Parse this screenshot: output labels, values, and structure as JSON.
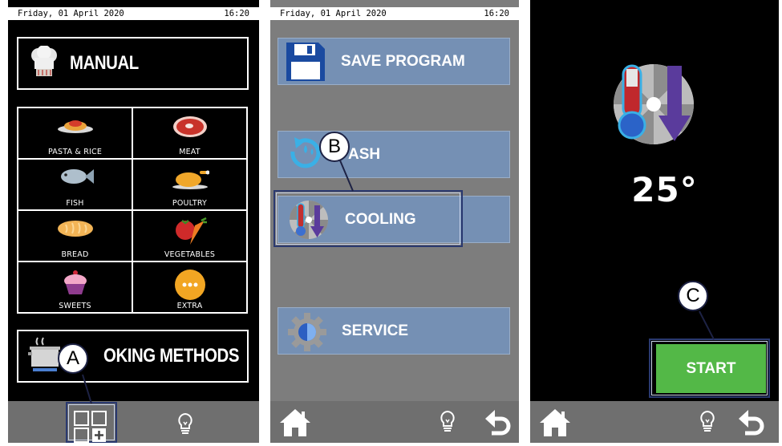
{
  "screen1": {
    "status": {
      "date": "Friday, 01 April 2020",
      "time": "16:20"
    },
    "manual_label": "MANUAL",
    "categories": [
      {
        "label": "PASTA & RICE",
        "icon": "pasta-icon"
      },
      {
        "label": "MEAT",
        "icon": "meat-icon"
      },
      {
        "label": "FISH",
        "icon": "fish-icon"
      },
      {
        "label": "POULTRY",
        "icon": "poultry-icon"
      },
      {
        "label": "BREAD",
        "icon": "bread-icon"
      },
      {
        "label": "VEGETABLES",
        "icon": "vegetables-icon"
      },
      {
        "label": "SWEETS",
        "icon": "sweets-icon"
      },
      {
        "label": "EXTRA",
        "icon": "extra-icon"
      }
    ],
    "cooking_methods_label": "OKING METHODS",
    "callout": "A"
  },
  "screen2": {
    "status": {
      "date": "Friday, 01 April 2020",
      "time": "16:20"
    },
    "save_label": "SAVE PROGRAM",
    "wash_label": "ASH",
    "cooling_label": "COOLING",
    "service_label": "SERVICE",
    "callout": "B"
  },
  "screen3": {
    "temperature": "25°",
    "start_label": "START",
    "callout": "C"
  },
  "colors": {
    "button_blue": "#7590b4",
    "start_green": "#53b847",
    "bar_gray": "#6f6f6f"
  }
}
